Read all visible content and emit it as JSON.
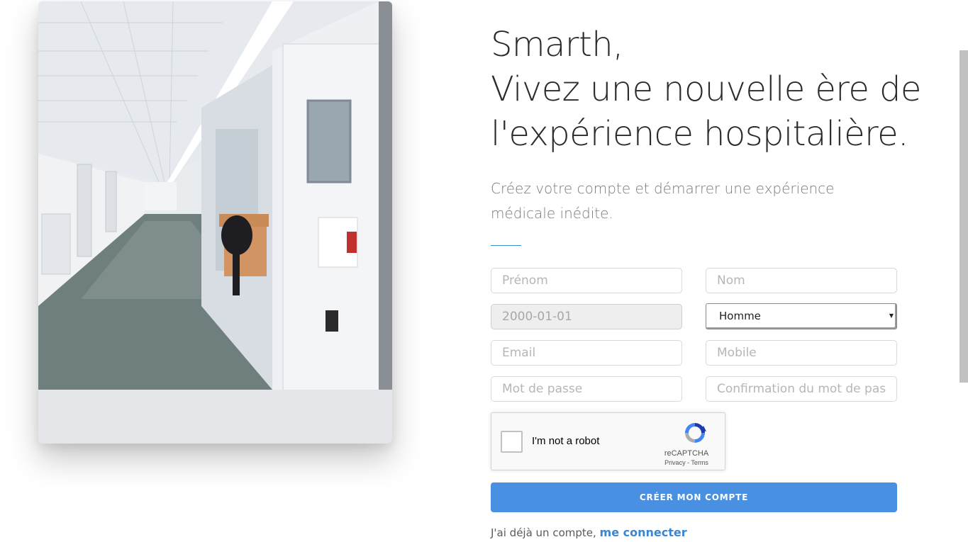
{
  "hero": {
    "title_line1": "Smarth,",
    "title_line2": "Vivez une nouvelle ère de",
    "title_line3": "l'expérience hospitalière.",
    "subtitle": "Créez votre compte et démarrer une expérience médicale inédite."
  },
  "form": {
    "first_name_placeholder": "Prénom",
    "last_name_placeholder": "Nom",
    "birthdate_placeholder": "2000-01-01",
    "gender_selected": "Homme",
    "email_placeholder": "Email",
    "mobile_placeholder": "Mobile",
    "password_placeholder": "Mot de passe",
    "password_confirm_placeholder": "Confirmation du mot de passe",
    "submit_label": "CRÉER MON COMPTE"
  },
  "captcha": {
    "label": "I'm not a robot",
    "brand": "reCAPTCHA",
    "privacy": "Privacy",
    "separator": " - ",
    "terms": "Terms"
  },
  "login": {
    "prompt": "J'ai déjà un compte, ",
    "link": "me connecter"
  },
  "colors": {
    "accent": "#4a90e2",
    "link": "#3b85d1",
    "divider": "#3b8ec9"
  }
}
